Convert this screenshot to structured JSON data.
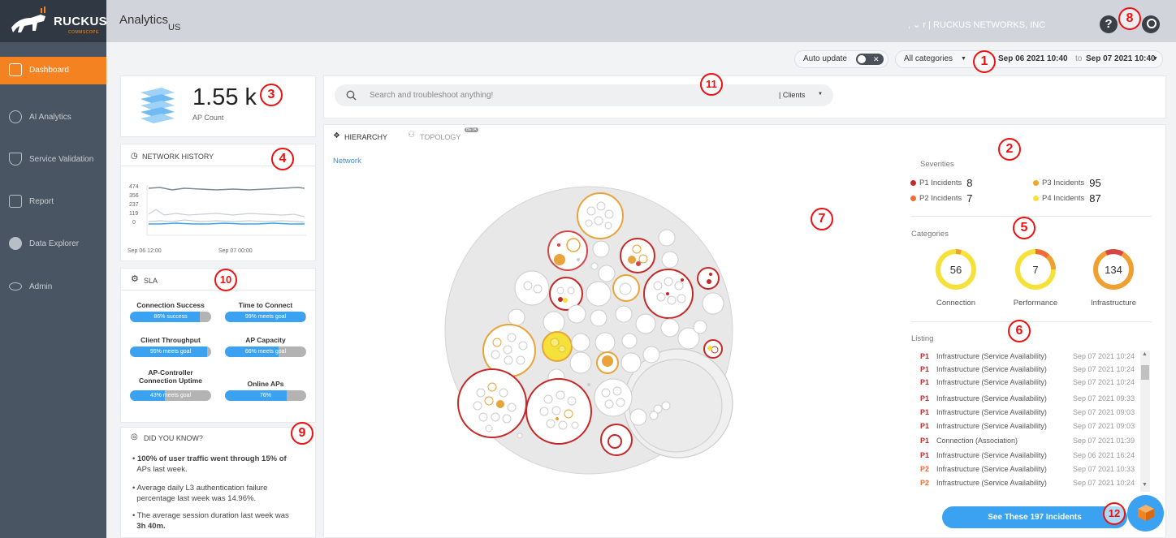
{
  "header": {
    "brand": "RUCKUS",
    "brand_sub": "COMMSCOPE",
    "title": "Analytics",
    "region": "US",
    "org": ", ⌄ r | RUCKUS NETWORKS, INC",
    "help": "?"
  },
  "sidebar": {
    "items": [
      {
        "label": "Dashboard",
        "icon": "dashboard-icon",
        "active": true
      },
      {
        "label": "AI Analytics",
        "icon": "brain-icon"
      },
      {
        "label": "Service Validation",
        "icon": "shield-icon"
      },
      {
        "label": "Report",
        "icon": "report-icon"
      },
      {
        "label": "Data Explorer",
        "icon": "pie-chart-icon"
      },
      {
        "label": "Admin",
        "icon": "eye-icon"
      }
    ]
  },
  "filters": {
    "auto_update_label": "Auto update",
    "auto_update_on": false,
    "category": "All categories",
    "date_from": "Sep 06 2021 10:40",
    "date_to_sep": "to",
    "date_to": "Sep 07 2021 10:40"
  },
  "ap_card": {
    "count": "1.55 k",
    "label": "AP Count"
  },
  "network_history": {
    "title": "NETWORK HISTORY",
    "y_ticks": [
      "474",
      "356",
      "237",
      "119",
      "0"
    ],
    "x_ticks": [
      "Sep 06 12:00",
      "Sep 07 00:00"
    ]
  },
  "sla": {
    "title": "SLA",
    "items": [
      {
        "name": "Connection Success",
        "text": "86% success",
        "pct": 0.86
      },
      {
        "name": "Time to Connect",
        "text": "99% meets goal",
        "pct": 0.99
      },
      {
        "name": "Client Throughput",
        "text": "95% meets goal",
        "pct": 0.95
      },
      {
        "name": "AP Capacity",
        "text": "66% meets goal",
        "pct": 0.66
      },
      {
        "name": "AP-Controller Connection Uptime",
        "text": "43% meets goal",
        "pct": 0.43
      },
      {
        "name": "Online APs",
        "text": "76%",
        "pct": 0.76
      }
    ]
  },
  "did_you_know": {
    "title": "DID YOU KNOW?",
    "items": [
      {
        "bold": "100% of user traffic went through 15% of",
        "text": "APs last week."
      },
      {
        "bold": "Average daily L3 authentication failure",
        "text": "percentage last week was 14.96%."
      },
      {
        "bold": "The average session duration last week was",
        "text": "3h 40m."
      }
    ]
  },
  "search": {
    "placeholder": "Search and troubleshoot anything!",
    "scope": "| Clients"
  },
  "tabs": {
    "hierarchy": "HIERARCHY",
    "topology": "TOPOLOGY",
    "beta": "BETA"
  },
  "breadcrumb": "Network",
  "severities": {
    "title": "Severities",
    "items": [
      {
        "label": "P1 Incidents",
        "count": "8",
        "color": "#c62828"
      },
      {
        "label": "P3 Incidents",
        "count": "95",
        "color": "#f5a623"
      },
      {
        "label": "P2 Incidents",
        "count": "7",
        "color": "#ef6c35"
      },
      {
        "label": "P4 Incidents",
        "count": "87",
        "color": "#f5e13a"
      }
    ]
  },
  "categories": {
    "title": "Categories",
    "items": [
      {
        "label": "Connection",
        "count": "56"
      },
      {
        "label": "Performance",
        "count": "7"
      },
      {
        "label": "Infrastructure",
        "count": "134"
      }
    ]
  },
  "listing": {
    "title": "Listing",
    "rows": [
      {
        "pri": "P1",
        "title": "Infrastructure (Service Availability)",
        "date": "Sep 07 2021 10:24"
      },
      {
        "pri": "P1",
        "title": "Infrastructure (Service Availability)",
        "date": "Sep 07 2021 10:24"
      },
      {
        "pri": "P1",
        "title": "Infrastructure (Service Availability)",
        "date": "Sep 07 2021 10:24"
      },
      {
        "pri": "P1",
        "title": "Infrastructure (Service Availability)",
        "date": "Sep 07 2021 09:33"
      },
      {
        "pri": "P1",
        "title": "Infrastructure (Service Availability)",
        "date": "Sep 07 2021 09:03"
      },
      {
        "pri": "P1",
        "title": "Infrastructure (Service Availability)",
        "date": "Sep 07 2021 09:03"
      },
      {
        "pri": "P1",
        "title": "Connection (Association)",
        "date": "Sep 07 2021 01:39"
      },
      {
        "pri": "P1",
        "title": "Infrastructure (Service Availability)",
        "date": "Sep 06 2021 16:24"
      },
      {
        "pri": "P2",
        "title": "Infrastructure (Service Availability)",
        "date": "Sep 07 2021 10:33"
      },
      {
        "pri": "P2",
        "title": "Infrastructure (Service Availability)",
        "date": "Sep 07 2021 10:24"
      }
    ],
    "button": "See These 197 Incidents"
  },
  "markers": [
    "1",
    "2",
    "3",
    "4",
    "5",
    "6",
    "7",
    "8",
    "9",
    "10",
    "11",
    "12"
  ]
}
